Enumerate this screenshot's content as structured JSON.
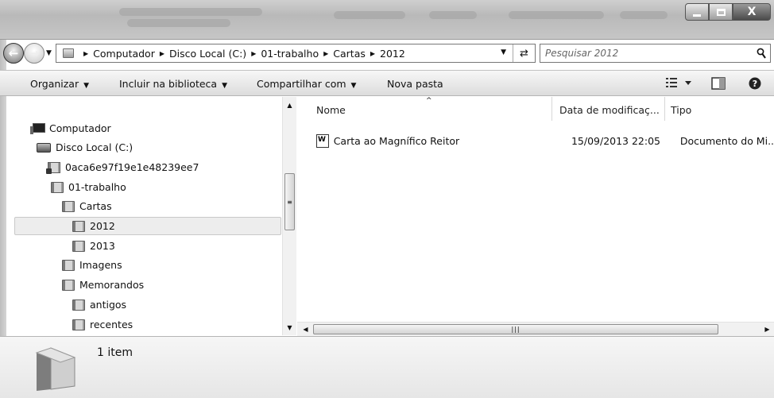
{
  "window": {
    "controls": {
      "close_label": "X"
    }
  },
  "navigation": {
    "breadcrumbs": [
      "Computador",
      "Disco Local (C:)",
      "01-trabalho",
      "Cartas",
      "2012"
    ],
    "search_placeholder": "Pesquisar 2012"
  },
  "toolbar": {
    "organize": "Organizar",
    "include_library": "Incluir na biblioteca",
    "share_with": "Compartilhar com",
    "new_folder": "Nova pasta"
  },
  "tree": {
    "items": [
      {
        "label": "Computador",
        "icon": "computer-icon"
      },
      {
        "label": "Disco Local (C:)",
        "icon": "drive-icon"
      },
      {
        "label": "0aca6e97f19e1e48239ee7",
        "icon": "locked-folder-icon"
      },
      {
        "label": "01-trabalho",
        "icon": "folder-icon"
      },
      {
        "label": "Cartas",
        "icon": "folder-icon"
      },
      {
        "label": "2012",
        "icon": "folder-icon",
        "selected": true
      },
      {
        "label": "2013",
        "icon": "folder-icon"
      },
      {
        "label": "Imagens",
        "icon": "folder-icon"
      },
      {
        "label": "Memorandos",
        "icon": "folder-icon"
      },
      {
        "label": "antigos",
        "icon": "folder-icon"
      },
      {
        "label": "recentes",
        "icon": "folder-icon"
      }
    ]
  },
  "filelist": {
    "columns": [
      "Nome",
      "Data de modificaç...",
      "Tipo"
    ],
    "rows": [
      {
        "name": "Carta ao Magnífico Reitor",
        "modified": "15/09/2013 22:05",
        "type": "Documento do Mi...",
        "icon": "word-document-icon"
      }
    ]
  },
  "details": {
    "item_count": "1 item"
  },
  "colors": {
    "selection": "#ededed",
    "toolbar": "#e8e8e8",
    "frame": "#c4c4c4"
  }
}
